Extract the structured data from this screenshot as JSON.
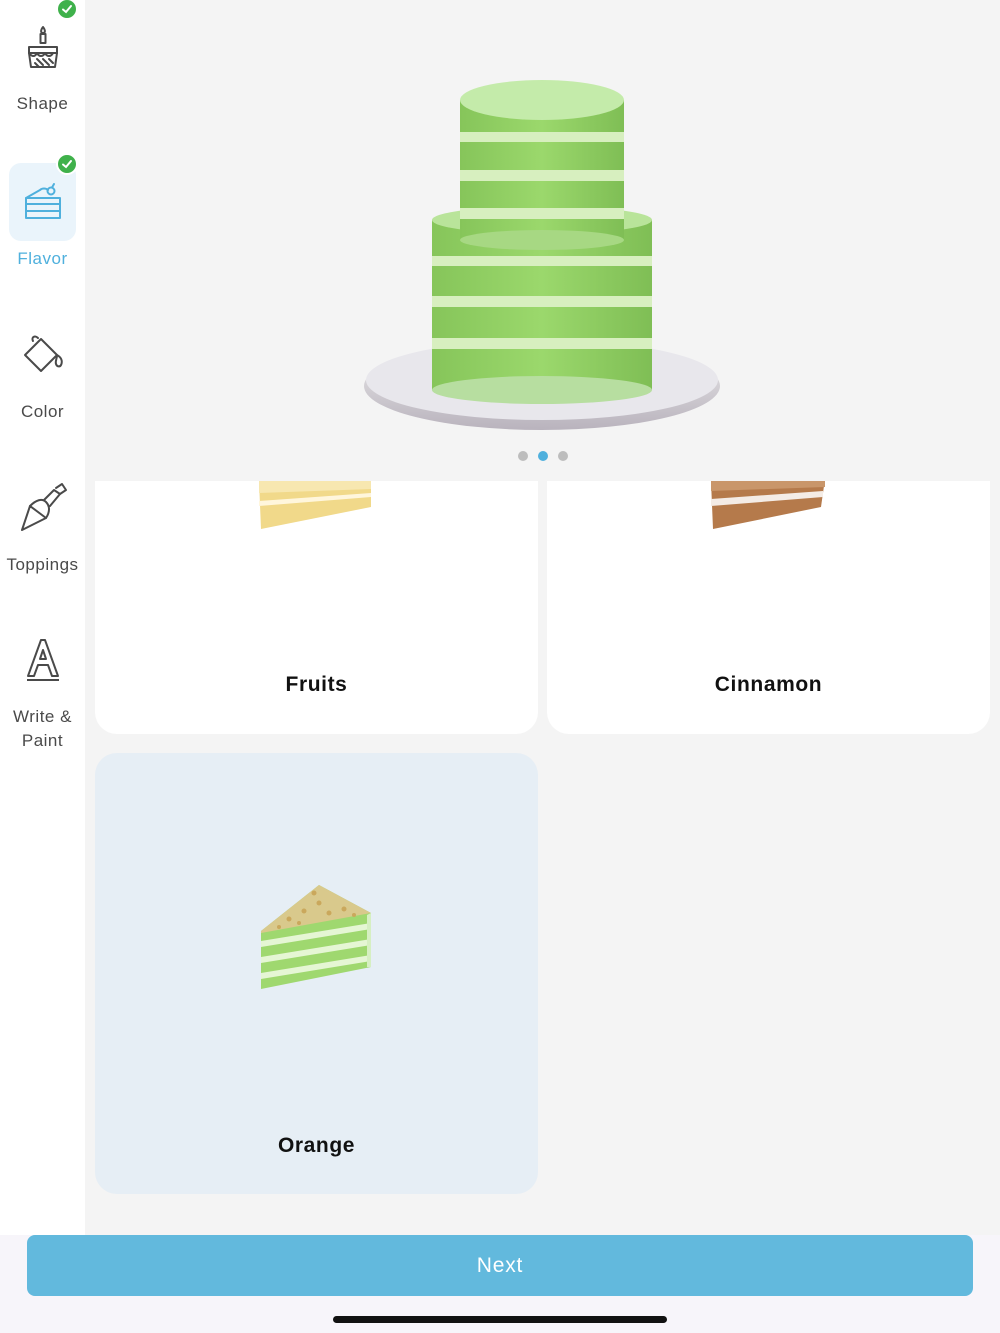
{
  "sidebar": {
    "items": [
      {
        "label": "Shape",
        "icon": "cake-birthday-icon",
        "completed": true,
        "active": false
      },
      {
        "label": "Flavor",
        "icon": "cake-slice-icon",
        "completed": true,
        "active": true
      },
      {
        "label": "Color",
        "icon": "paint-bucket-icon",
        "completed": false,
        "active": false
      },
      {
        "label": "Toppings",
        "icon": "piping-bag-icon",
        "completed": false,
        "active": false
      },
      {
        "label": "Write &\nPaint",
        "icon": "letter-a-icon",
        "completed": false,
        "active": false
      }
    ]
  },
  "preview": {
    "carousel": {
      "page_count": 3,
      "current_page": 2
    }
  },
  "flavors": [
    {
      "label": "Fruits",
      "selected": false
    },
    {
      "label": "Cinnamon",
      "selected": false
    },
    {
      "label": "Orange",
      "selected": true
    }
  ],
  "footer": {
    "next_label": "Next"
  },
  "colors": {
    "accent": "#4fb0dd",
    "button": "#62b9dd",
    "check": "#3fb14b",
    "cake_green": "#8fce5e",
    "selected_card": "#e6eef5"
  }
}
